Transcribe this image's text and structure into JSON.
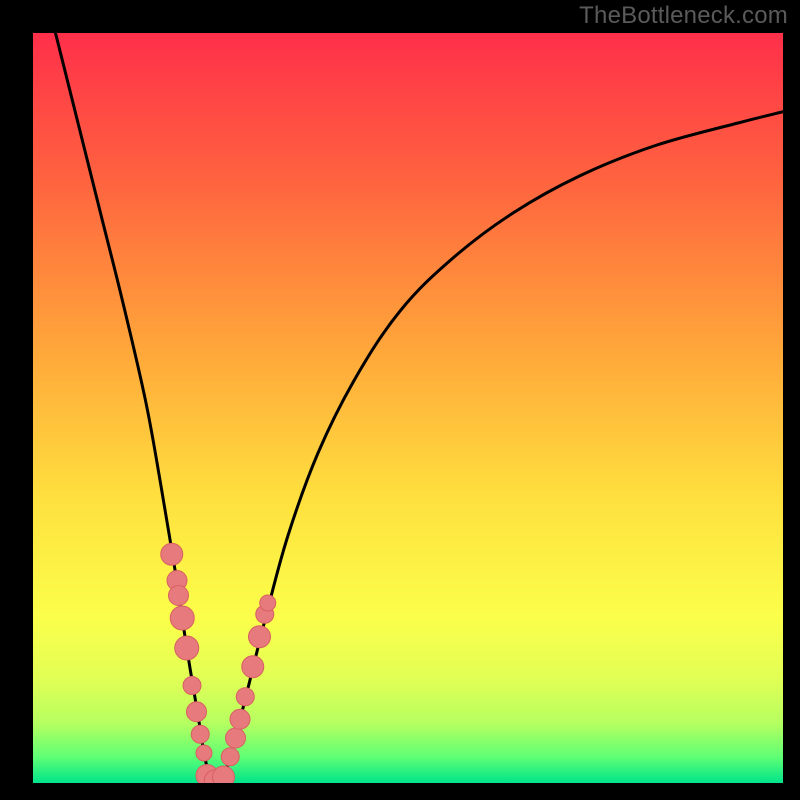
{
  "watermark": "TheBottleneck.com",
  "colors": {
    "frame": "#000000",
    "curve": "#000000",
    "marker_fill": "#e77a7c",
    "marker_stroke": "#d85f63",
    "gradient_stops": [
      {
        "offset": 0.0,
        "color": "#ff2f4a"
      },
      {
        "offset": 0.2,
        "color": "#ff643f"
      },
      {
        "offset": 0.42,
        "color": "#ffa63a"
      },
      {
        "offset": 0.62,
        "color": "#ffe03e"
      },
      {
        "offset": 0.78,
        "color": "#fbff4a"
      },
      {
        "offset": 0.86,
        "color": "#e2ff55"
      },
      {
        "offset": 0.92,
        "color": "#b6ff60"
      },
      {
        "offset": 0.965,
        "color": "#5fff74"
      },
      {
        "offset": 1.0,
        "color": "#00e48a"
      }
    ]
  },
  "layout": {
    "outer_w": 800,
    "outer_h": 800,
    "inner_left": 33,
    "inner_top": 33,
    "inner_w": 750,
    "inner_h": 750
  },
  "chart_data": {
    "type": "line",
    "title": "",
    "xlabel": "",
    "ylabel": "",
    "xlim": [
      0,
      100
    ],
    "ylim": [
      0,
      100
    ],
    "x_optimum": 24,
    "series": [
      {
        "name": "bottleneck-curve",
        "x": [
          3,
          6,
          9,
          12,
          15,
          17,
          19,
          20.5,
          22,
          23,
          24,
          25,
          26,
          27,
          29,
          31,
          34,
          38,
          43,
          49,
          56,
          64,
          73,
          83,
          94,
          100
        ],
        "y": [
          100,
          88,
          76,
          64,
          51,
          40,
          28,
          18,
          9,
          3,
          0,
          0.5,
          2.5,
          6,
          14,
          22,
          33,
          44,
          54,
          63,
          70,
          76,
          81,
          85,
          88,
          89.5
        ]
      }
    ],
    "markers": {
      "left": {
        "x": [
          18.5,
          19.2,
          19.4,
          19.9,
          20.5,
          21.2,
          21.8,
          22.3,
          22.8
        ],
        "y": [
          30.5,
          27.0,
          25.0,
          22.0,
          18.0,
          13.0,
          9.5,
          6.5,
          4.0
        ],
        "r": [
          11,
          10,
          10,
          12,
          12,
          9,
          10,
          9,
          8
        ]
      },
      "right": {
        "x": [
          26.3,
          27.0,
          27.6,
          28.3,
          29.3,
          30.2,
          30.9,
          31.3
        ],
        "y": [
          3.5,
          6.0,
          8.5,
          11.5,
          15.5,
          19.5,
          22.5,
          24.0
        ],
        "r": [
          9,
          10,
          10,
          9,
          11,
          11,
          9,
          8
        ]
      },
      "bottom": {
        "x": [
          23.2,
          24.3,
          25.4
        ],
        "y": [
          1.0,
          0.3,
          0.8
        ],
        "r": [
          11,
          11,
          11
        ]
      }
    }
  }
}
